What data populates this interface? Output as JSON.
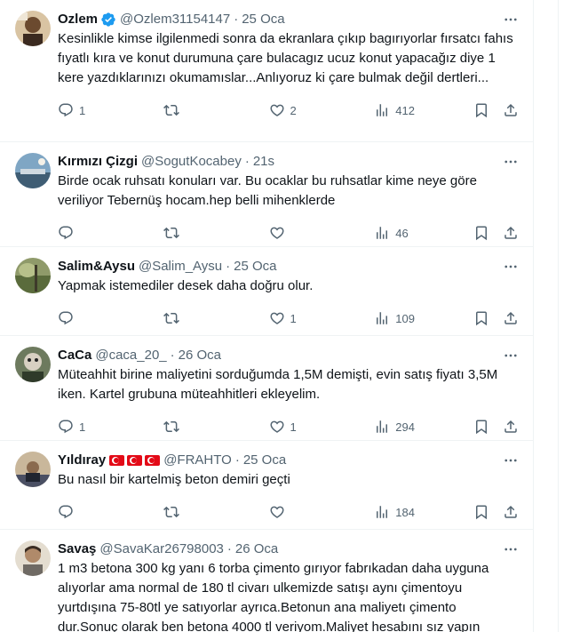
{
  "tweets": [
    {
      "name": "Ozlem",
      "verified": true,
      "flags": 0,
      "handle": "@Ozlem31154147",
      "time": "25 Oca",
      "text": "Kesinlikle kimse ilgilenmedi sonra da ekranlara çıkıp bagırıyorlar fırsatcı fahıs fıyatlı kıra ve konut durumuna çare bulacagız ucuz konut yapacağız diye 1 kere yazdıklarınızı okumamıslar...Anlıyoruz ki çare bulmak değil dertleri...",
      "replies": "1",
      "retweets": "",
      "likes": "2",
      "views": "412"
    },
    {
      "name": "Kırmızı Çizgi",
      "verified": false,
      "flags": 0,
      "handle": "@SogutKocabey",
      "time": "21s",
      "text": "Birde ocak ruhsatı konuları var. Bu ocaklar bu ruhsatlar kime neye göre veriliyor Tebernüş hocam.hep belli mihenklerde",
      "replies": "",
      "retweets": "",
      "likes": "",
      "views": "46"
    },
    {
      "name": "Salim&Aysu",
      "verified": false,
      "flags": 0,
      "handle": "@Salim_Aysu",
      "time": "25 Oca",
      "text": "Yapmak istemediler desek daha doğru olur.",
      "replies": "",
      "retweets": "",
      "likes": "1",
      "views": "109"
    },
    {
      "name": "CaCa",
      "verified": false,
      "flags": 0,
      "handle": "@caca_20_",
      "time": "26 Oca",
      "text": "Müteahhit birine maliyetini sorduğumda 1,5M demişti, evin satış fiyatı 3,5M iken. Kartel grubuna müteahhitleri ekleyelim.",
      "replies": "1",
      "retweets": "",
      "likes": "1",
      "views": "294"
    },
    {
      "name": "Yıldıray",
      "verified": false,
      "flags": 3,
      "handle": "@FRAHTO",
      "time": "25 Oca",
      "text": "Bu nasıl bir kartelmiş beton demiri geçti",
      "replies": "",
      "retweets": "",
      "likes": "",
      "views": "184"
    },
    {
      "name": "Savaş",
      "verified": false,
      "flags": 0,
      "handle": "@SavaKar26798003",
      "time": "26 Oca",
      "text": "1 m3 betona 300 kg yanı 6 torba çimento gırıyor fabrıkadan daha uyguna alıyorlar ama normal de 180 tl civarı ulkemizde satışı aynı çimentoyu yurtdışına 75-80tl ye satıyorlar ayrıca.Betonun ana maliyetı çimento dur.Sonuç olarak ben betona 4000 tl veriyom.Maliyet hesabını sız yapın",
      "replies": "",
      "retweets": "",
      "likes": "",
      "views": ""
    }
  ],
  "colors": {
    "text": "#0f1419",
    "muted": "#536471",
    "verified": "#1d9bf0",
    "border": "#eff3f4"
  },
  "icons": {
    "reply": "reply-icon",
    "retweet": "retweet-icon",
    "like": "heart-icon",
    "views": "views-icon",
    "bookmark": "bookmark-icon",
    "share": "share-icon",
    "more": "more-icon"
  }
}
